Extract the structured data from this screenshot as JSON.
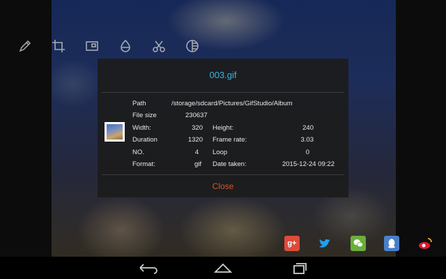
{
  "toolbar": {
    "icons": [
      "pencil-icon",
      "crop-icon",
      "frame-icon",
      "brightness-icon",
      "scissors-icon",
      "effects-icon"
    ]
  },
  "dialog": {
    "title": "003.gif",
    "path_label": "Path",
    "path_value": "/storage/sdcard/Pictures/GifStudio/Album",
    "filesize_label": "File size",
    "filesize_value": "230637",
    "width_label": "Width:",
    "width_value": "320",
    "height_label": "Height:",
    "height_value": "240",
    "duration_label": "Duration",
    "duration_value": "1320",
    "framerate_label": "Frame rate:",
    "framerate_value": "3.03",
    "no_label": "NO.",
    "no_value": "4",
    "loop_label": "Loop",
    "loop_value": "0",
    "format_label": "Format:",
    "format_value": "gif",
    "date_label": "Date taken:",
    "date_value": "2015-12-24 09:22",
    "close_label": "Close"
  },
  "share": {
    "gplus_label": "g+",
    "colors": {
      "gplus": "#dd4b39",
      "twitter": "#1da1f2",
      "wechat": "#6aae3c",
      "qq": "#4a7fc8",
      "weibo": "#e6162d"
    }
  },
  "colors": {
    "accent": "#33b5e5",
    "close": "#d4542a"
  }
}
